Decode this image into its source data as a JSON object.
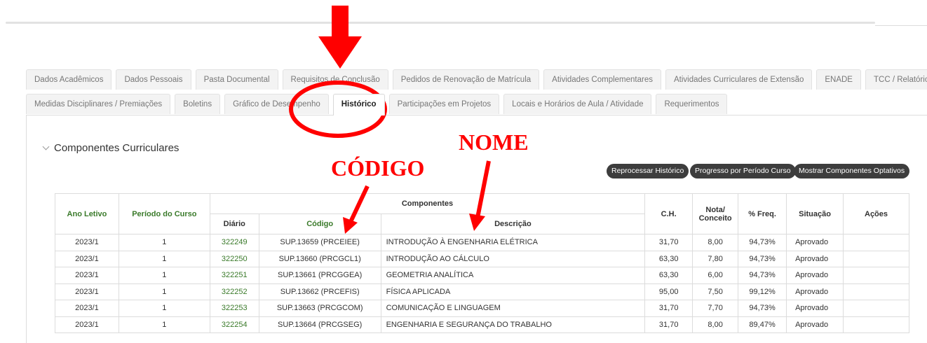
{
  "tabs_row1": [
    "Dados Acadêmicos",
    "Dados Pessoais",
    "Pasta Documental",
    "Requisitos de Conclusão",
    "Pedidos de Renovação de Matrícula",
    "Atividades Complementares",
    "Atividades Curriculares de Extensão",
    "ENADE",
    "TCC / Relatórios"
  ],
  "tabs_row2": [
    "Medidas Disciplinares / Premiações",
    "Boletins",
    "Gráfico de Desempenho",
    "Histórico",
    "Participações em Projetos",
    "Locais e Horários de Aula / Atividade",
    "Requerimentos"
  ],
  "active_tab": "Histórico",
  "section": {
    "title": "Componentes Curriculares"
  },
  "buttons": {
    "reprocess": "Reprocessar Histórico",
    "progress": "Progresso por Período Curso",
    "optional": "Mostrar Componentes Optativos"
  },
  "annotations": {
    "codigo": "CÓDIGO",
    "nome": "NOME"
  },
  "table": {
    "headers": {
      "ano": "Ano Letivo",
      "periodo": "Período do Curso",
      "componentes": "Componentes",
      "diario": "Diário",
      "codigo": "Código",
      "descricao": "Descrição",
      "ch": "C.H.",
      "nota": "Nota/ Conceito",
      "freq": "% Freq.",
      "situacao": "Situação",
      "acoes": "Ações"
    },
    "rows": [
      {
        "ano": "2023/1",
        "periodo": "1",
        "diario": "322249",
        "codigo": "SUP.13659 (PRCEIEE)",
        "descricao": "INTRODUÇÃO À ENGENHARIA ELÉTRICA",
        "ch": "31,70",
        "nota": "8,00",
        "freq": "94,73%",
        "situacao": "Aprovado"
      },
      {
        "ano": "2023/1",
        "periodo": "1",
        "diario": "322250",
        "codigo": "SUP.13660 (PRCGCL1)",
        "descricao": "INTRODUÇÃO AO CÁLCULO",
        "ch": "63,30",
        "nota": "7,80",
        "freq": "94,73%",
        "situacao": "Aprovado"
      },
      {
        "ano": "2023/1",
        "periodo": "1",
        "diario": "322251",
        "codigo": "SUP.13661 (PRCGGEA)",
        "descricao": "GEOMETRIA ANALÍTICA",
        "ch": "63,30",
        "nota": "6,00",
        "freq": "94,73%",
        "situacao": "Aprovado"
      },
      {
        "ano": "2023/1",
        "periodo": "1",
        "diario": "322252",
        "codigo": "SUP.13662 (PRCEFIS)",
        "descricao": "FÍSICA APLICADA",
        "ch": "95,00",
        "nota": "7,50",
        "freq": "99,12%",
        "situacao": "Aprovado"
      },
      {
        "ano": "2023/1",
        "periodo": "1",
        "diario": "322253",
        "codigo": "SUP.13663 (PRCGCOM)",
        "descricao": "COMUNICAÇÃO E LINGUAGEM",
        "ch": "31,70",
        "nota": "7,70",
        "freq": "94,73%",
        "situacao": "Aprovado"
      },
      {
        "ano": "2023/1",
        "periodo": "1",
        "diario": "322254",
        "codigo": "SUP.13664 (PRCGSEG)",
        "descricao": "ENGENHARIA E SEGURANÇA DO TRABALHO",
        "ch": "31,70",
        "nota": "8,00",
        "freq": "89,47%",
        "situacao": "Aprovado"
      }
    ]
  },
  "colors": {
    "annotation": "#ff0000",
    "link_green": "#3a7a2a",
    "button_dark": "#3d3d3d"
  }
}
